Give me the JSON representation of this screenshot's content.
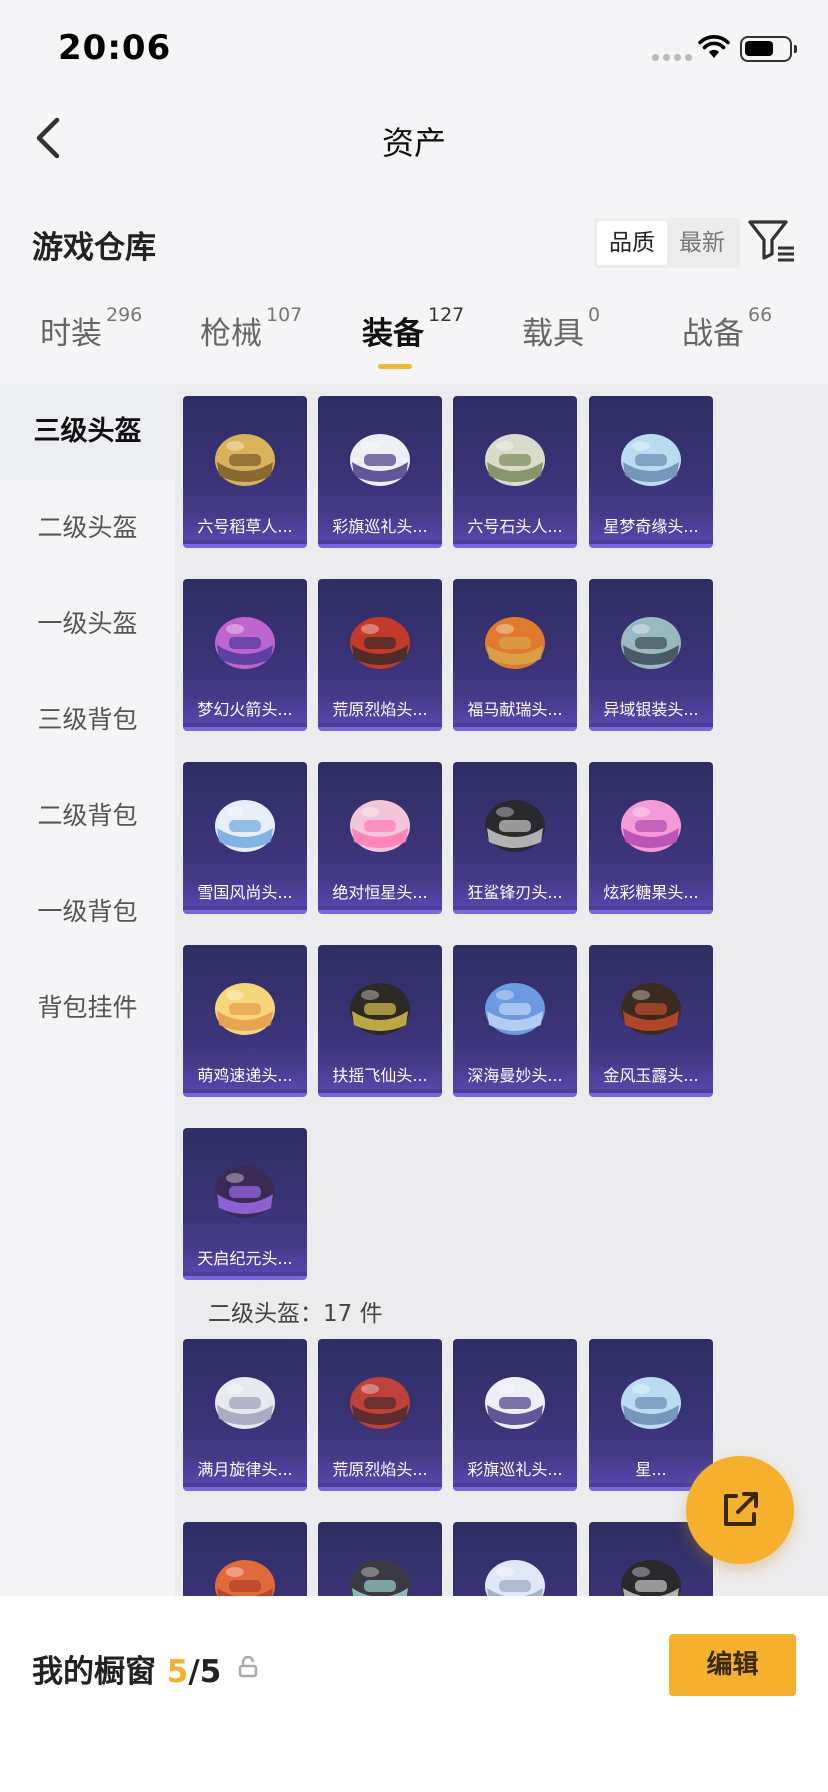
{
  "status": {
    "time": "20:06"
  },
  "nav": {
    "title": "资产"
  },
  "header": {
    "title": "游戏仓库",
    "sort_options": [
      "品质",
      "最新"
    ]
  },
  "tabs": [
    {
      "label": "时装",
      "count": "296"
    },
    {
      "label": "枪械",
      "count": "107"
    },
    {
      "label": "装备",
      "count": "127"
    },
    {
      "label": "载具",
      "count": "0"
    },
    {
      "label": "战备",
      "count": "66"
    }
  ],
  "sidebar": [
    "三级头盔",
    "二级头盔",
    "一级头盔",
    "三级背包",
    "二级背包",
    "一级背包",
    "背包挂件"
  ],
  "section1_items": [
    "六号稻草人...",
    "彩旗巡礼头...",
    "六号石头人...",
    "星梦奇缘头...",
    "梦幻火箭头...",
    "荒原烈焰头...",
    "福马献瑞头...",
    "异域银装头...",
    "雪国风尚头...",
    "绝对恒星头...",
    "狂鲨锋刃头...",
    "炫彩糖果头...",
    "萌鸡速递头...",
    "扶摇飞仙头...",
    "深海曼妙头...",
    "金风玉露头...",
    "天启纪元头..."
  ],
  "section2": {
    "title": "二级头盔：17 件",
    "items": [
      "满月旋律头...",
      "荒原烈焰头...",
      "彩旗巡礼头...",
      "星..."
    ]
  },
  "bottom": {
    "label": "我的橱窗",
    "current": "5",
    "total": "/5",
    "edit": "编辑"
  },
  "colors": {
    "accent": "#f5b12e",
    "card_bg": "#3a3377",
    "card_border": "#7b63e6"
  },
  "icons": [
    "back-arrow-icon",
    "filter-icon",
    "share-icon",
    "lock-icon",
    "wifi-icon",
    "battery-icon"
  ]
}
